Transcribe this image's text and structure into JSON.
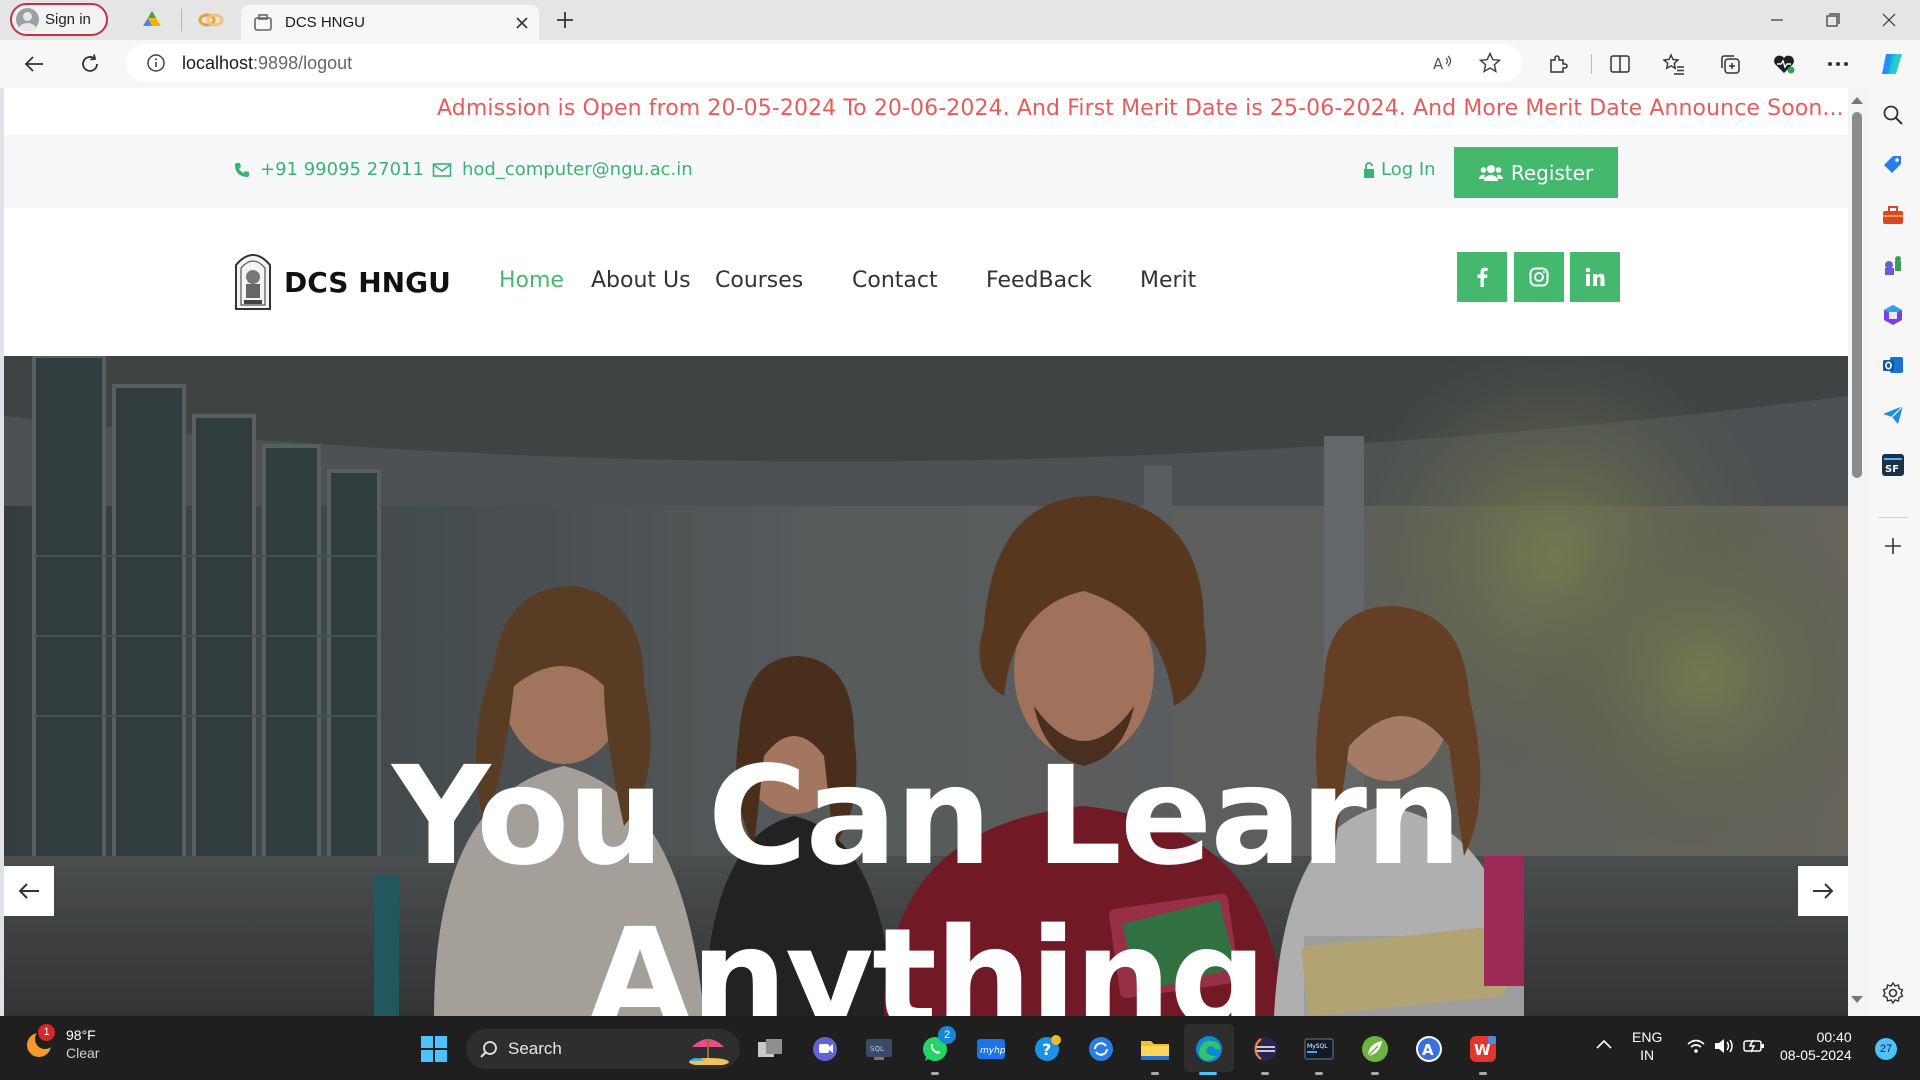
{
  "browser": {
    "profile_label": "Sign in",
    "tab_title": "DCS HNGU",
    "url_host": "localhost",
    "url_path": ":9898/logout"
  },
  "page": {
    "announcement": "Admission is Open from 20-05-2024 To 20-06-2024. And First Merit Date is 25-06-2024. And More Merit Date Announce Soon...",
    "phone": "+91 99095 27011",
    "email": "hod_computer@ngu.ac.in",
    "login_label": "Log In",
    "register_label": "Register",
    "brand": "DCS HNGU",
    "nav": {
      "home": "Home",
      "about": "About Us",
      "courses": "Courses",
      "contact": "Contact",
      "feedback": "FeedBack",
      "merit": "Merit"
    },
    "hero_title_line1": "You Can Learn",
    "hero_title_line2": "Anything"
  },
  "taskbar": {
    "temperature": "98°F",
    "condition": "Clear",
    "weather_badge": "1",
    "search_label": "Search",
    "whatsapp_badge": "2",
    "lang_line1": "ENG",
    "lang_line2": "IN",
    "time": "00:40",
    "date": "08-05-2024",
    "notification_count": "27"
  },
  "colors": {
    "accent_green": "#44b96e",
    "announcement_red": "#e65c5c"
  }
}
